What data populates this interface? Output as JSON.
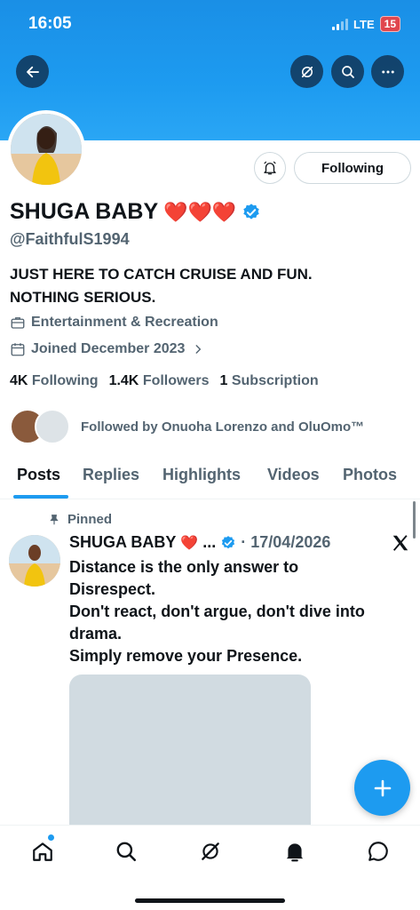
{
  "status_bar": {
    "time": "16:05",
    "network": "LTE",
    "battery": "15"
  },
  "profile": {
    "name": "SHUGA BABY",
    "name_emoji": "❤️❤️❤️",
    "handle": "@FaithfulS1994",
    "bio_line1": "JUST HERE TO CATCH CRUISE AND FUN.",
    "bio_line2": "NOTHING SERIOUS.",
    "category": "Entertainment & Recreation",
    "joined": "Joined December 2023",
    "following_count": "4K",
    "following_label": "Following",
    "followers_count": "1.4K",
    "followers_label": "Followers",
    "subscription_count": "1",
    "subscription_label": "Subscription",
    "followed_by": "Followed by Onuoha Lorenzo and OluOmo™",
    "follow_button": "Following"
  },
  "tabs": [
    "Posts",
    "Replies",
    "Highlights",
    "Videos",
    "Photos"
  ],
  "post": {
    "pinned_label": "Pinned",
    "author": "SHUGA BABY",
    "author_emoji": "❤️",
    "ellipsis": "...",
    "date": "· 17/04/2026",
    "text_line1": "Distance is the only answer to",
    "text_line2": "Disrespect.",
    "text_line3": "Don't react, don't argue, don't dive into",
    "text_line4": "drama.",
    "text_line5": "Simply remove your Presence."
  },
  "icons": {
    "back": "back-arrow-icon",
    "grok": "grok-icon",
    "search": "search-icon",
    "more": "more-icon",
    "bell": "notification-bell-icon",
    "briefcase": "briefcase-icon",
    "calendar": "calendar-icon",
    "pin": "pin-icon",
    "verified": "verified-badge-icon",
    "x": "x-logo-icon",
    "compose": "plus-icon",
    "nav": [
      "home-icon",
      "search-icon",
      "grok-icon",
      "notification-bell-icon",
      "messages-icon"
    ]
  },
  "colors": {
    "accent": "#1d9bf0",
    "text": "#0f1419",
    "muted": "#536471"
  }
}
